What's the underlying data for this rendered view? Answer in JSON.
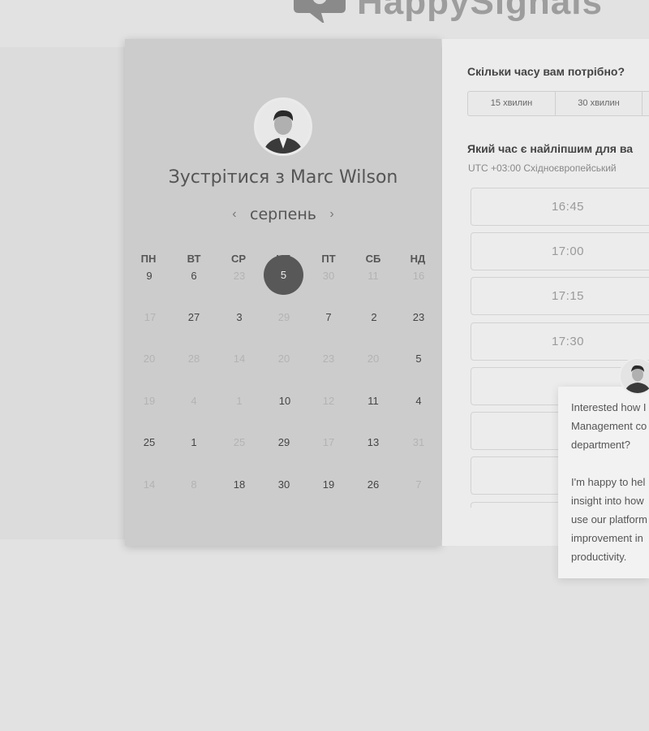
{
  "brand": {
    "logo_text": "HappySignals"
  },
  "calendar": {
    "title": "Зустрітися з Marc Wilson",
    "month": "серпень",
    "prev_icon": "‹",
    "next_icon": "›",
    "weekdays": [
      "ПН",
      "ВТ",
      "СР",
      "ЧТ",
      "ПТ",
      "СБ",
      "НД"
    ],
    "selected_day": "5",
    "rows": [
      [
        "9",
        "6",
        "23",
        "5",
        "30",
        "11",
        "16"
      ],
      [
        "17",
        "27",
        "3",
        "29",
        "7",
        "2",
        "23"
      ],
      [
        "20",
        "28",
        "14",
        "20",
        "23",
        "20",
        "5"
      ],
      [
        "19",
        "4",
        "1",
        "10",
        "12",
        "11",
        "4"
      ],
      [
        "25",
        "1",
        "25",
        "29",
        "17",
        "13",
        "31"
      ],
      [
        "14",
        "8",
        "18",
        "30",
        "19",
        "26",
        "7"
      ]
    ]
  },
  "duration": {
    "question": "Скільки часу вам потрібно?",
    "options": [
      "15 хвилин",
      "30 хвилин"
    ]
  },
  "time": {
    "question": "Який час є найліпшим для ва",
    "timezone": "UTC +03:00 Східноєвропейський",
    "slots": [
      "16:45",
      "17:00",
      "17:15",
      "17:30",
      "",
      "",
      "",
      ""
    ]
  },
  "chat": {
    "message_1": [
      "Interested how I",
      "Management co",
      "department?"
    ],
    "message_2": [
      "I'm happy to hel",
      "insight into how",
      "use our platform",
      "improvement in",
      "productivity."
    ]
  }
}
